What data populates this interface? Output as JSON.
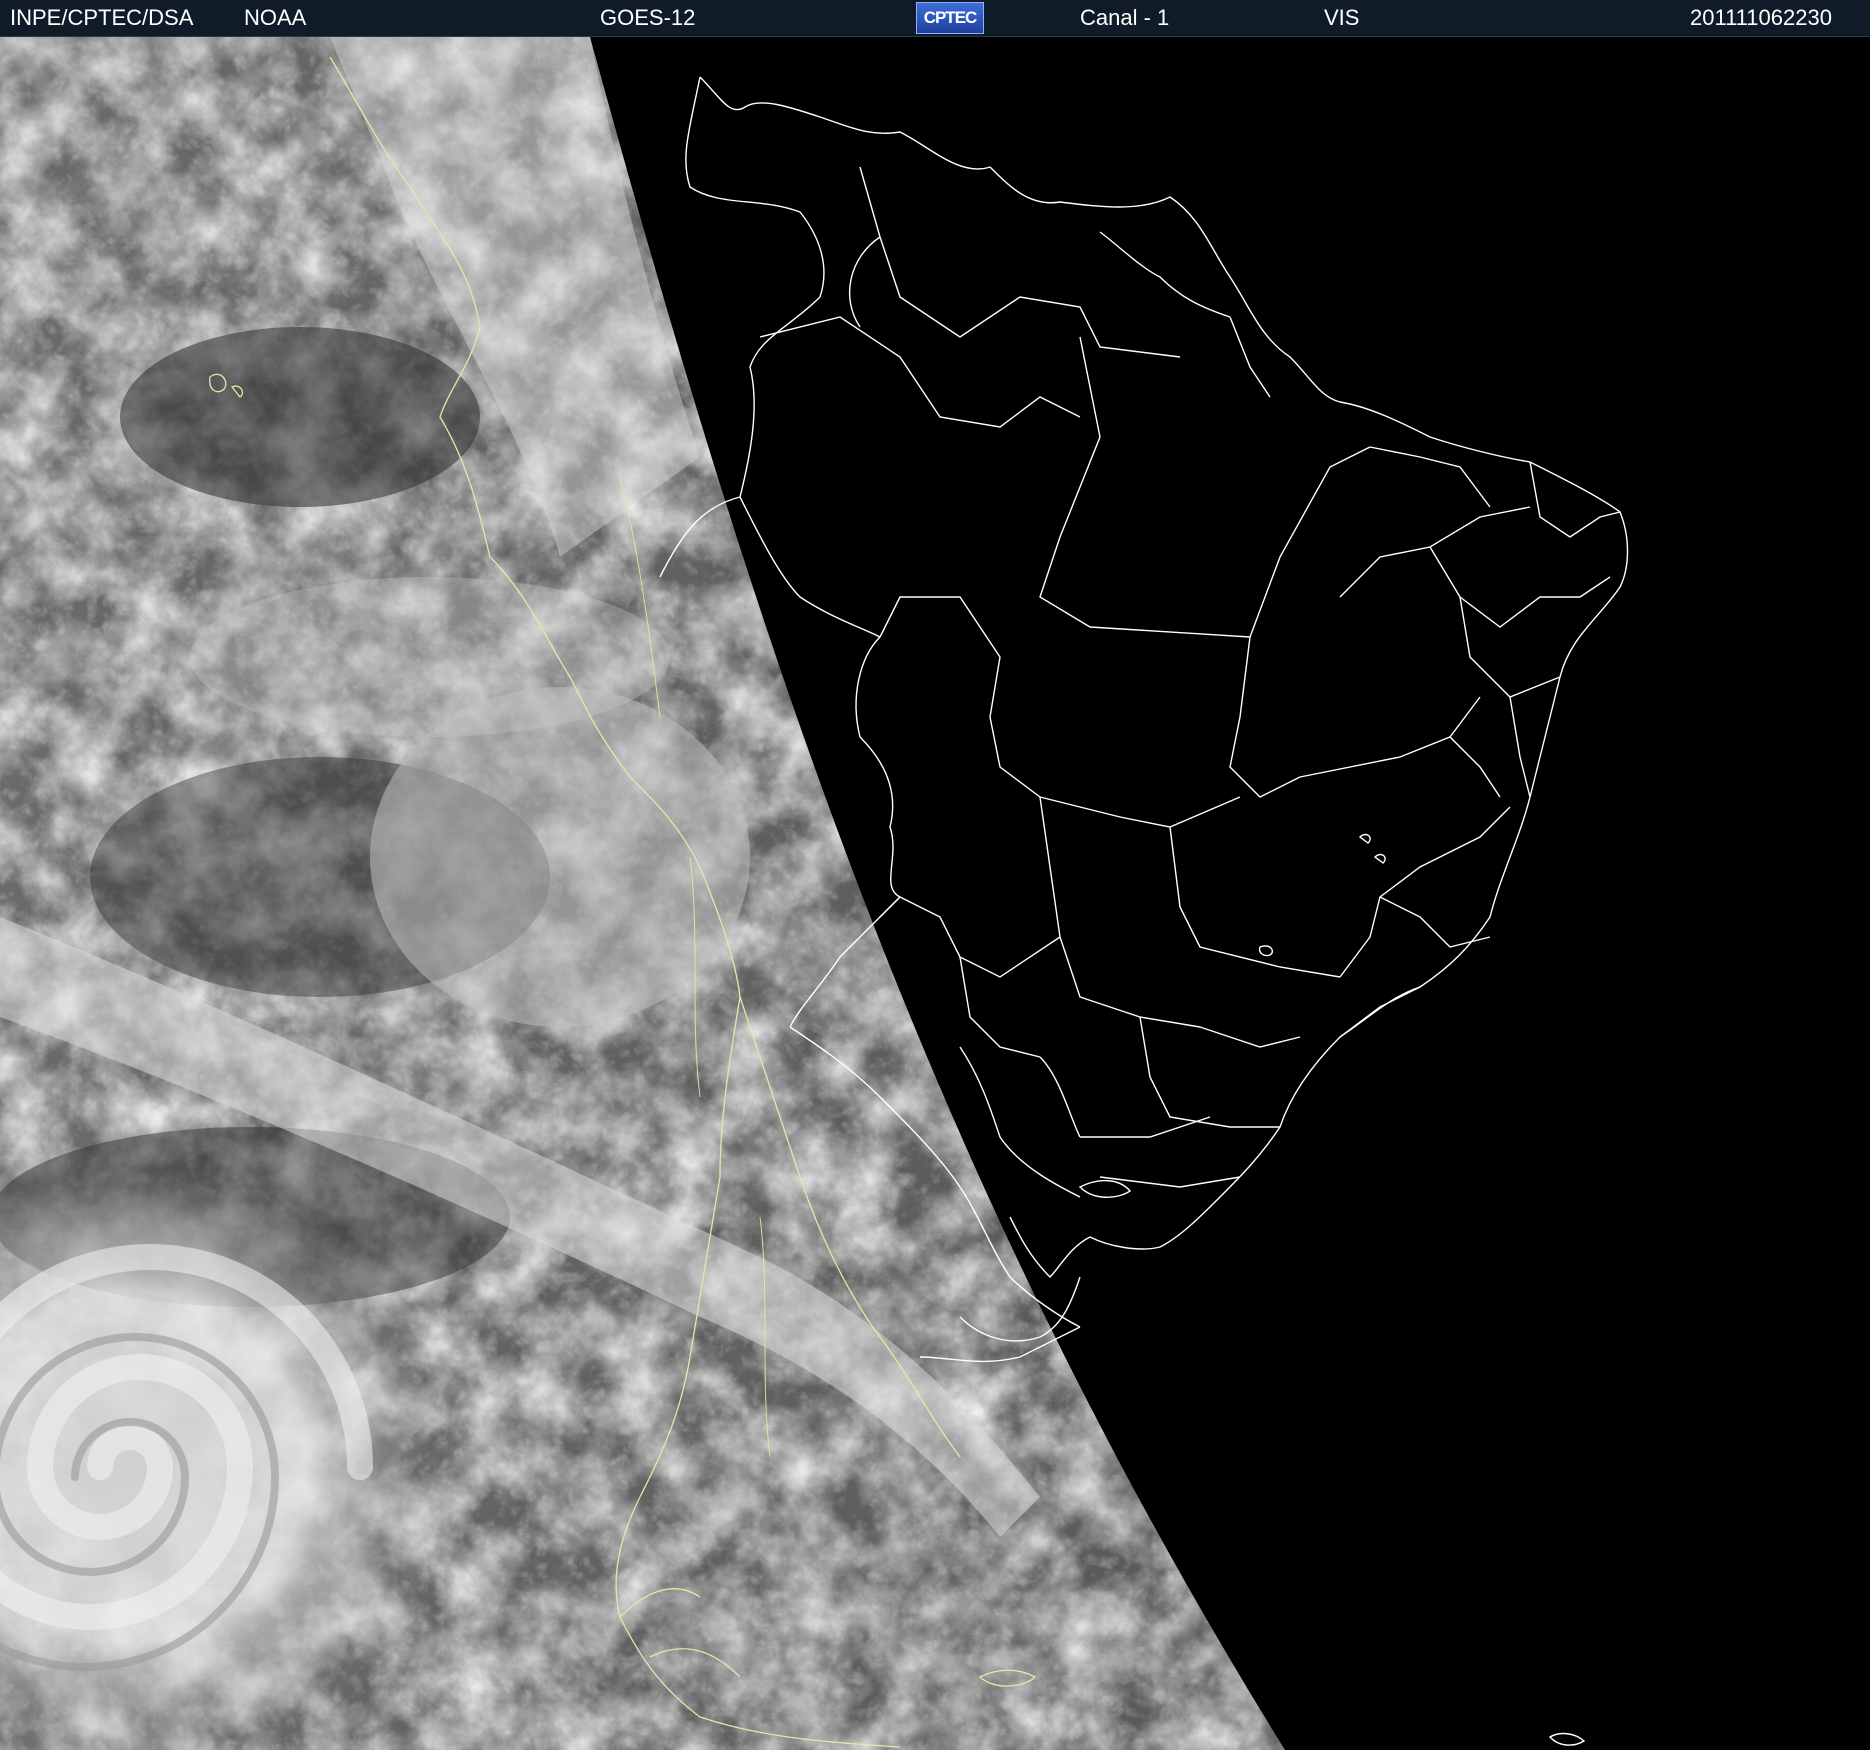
{
  "header": {
    "source": "INPE/CPTEC/DSA",
    "agency": "NOAA",
    "satellite": "GOES-12",
    "logo_text": "CPTEC",
    "channel": "Canal - 1",
    "band": "VIS",
    "timestamp": "201111062230"
  },
  "colors": {
    "header_bg": "#0f1c28",
    "night_side": "#000000",
    "political_borders": "#ffffff",
    "coastline_daylight": "#e8e6a8",
    "logo_bg": "#2a52be"
  },
  "icons": {
    "logo": "cptec-logo"
  }
}
